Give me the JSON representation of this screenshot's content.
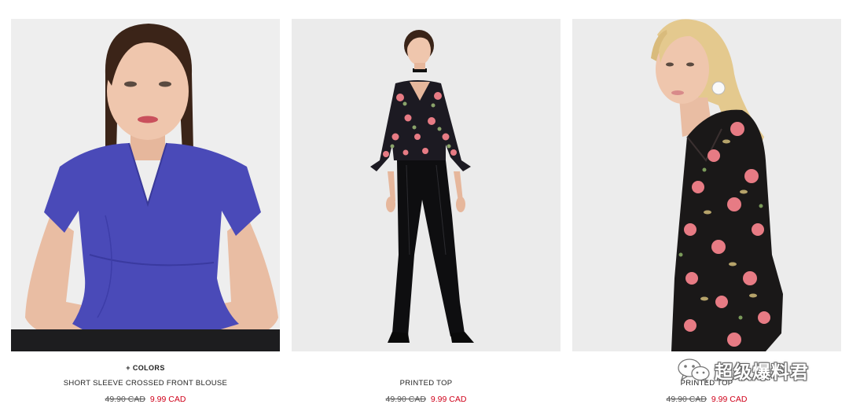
{
  "colors": {
    "price_sale": "#d0021b",
    "price_old": "#555555",
    "image_bg": "#ececec"
  },
  "products": [
    {
      "colors_link": "+ COLORS",
      "name": "SHORT SLEEVE CROSSED FRONT BLOUSE",
      "old_price": "49.90 CAD",
      "price": "9.99 CAD",
      "image_alt": "Model wearing blue short sleeve crossed front blouse"
    },
    {
      "colors_link": "",
      "name": "PRINTED TOP",
      "old_price": "49.90 CAD",
      "price": "9.99 CAD",
      "image_alt": "Model wearing floral printed top with black trousers"
    },
    {
      "colors_link": "",
      "name": "PRINTED TOP",
      "old_price": "49.90 CAD",
      "price": "9.99 CAD",
      "image_alt": "Model wearing black floral printed top"
    }
  ],
  "watermark": {
    "icon": "wechat-icon",
    "text": "超级爆料君"
  }
}
